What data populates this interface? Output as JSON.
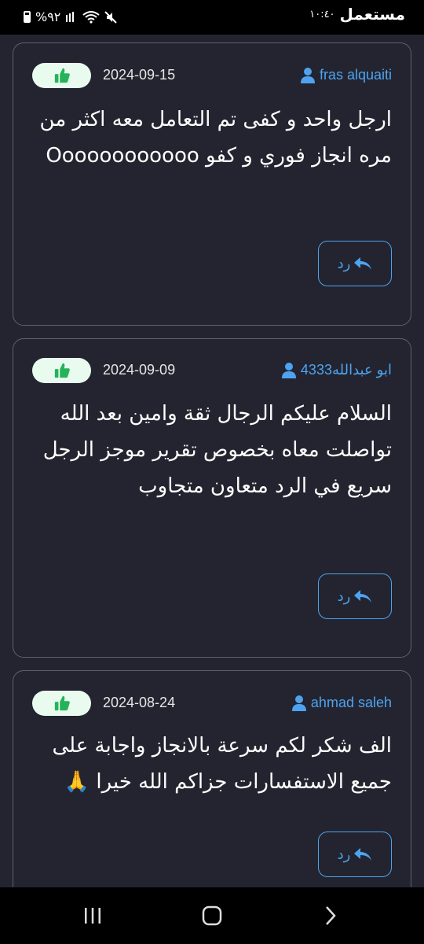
{
  "status_bar": {
    "battery": "%٩٢",
    "time": "١٠:٤٠",
    "app_logo": "مستعمل",
    "icons": [
      "battery-icon",
      "signal-icon",
      "wifi-icon",
      "mute-icon"
    ]
  },
  "colors": {
    "background": "#23242f",
    "card_border": "#5f6070",
    "accent": "#4ea3f1",
    "like_bg": "#e9fbef",
    "like_icon": "#25b35a"
  },
  "reviews": [
    {
      "author": "fras alquaiti",
      "date": "2024-09-15",
      "text": "ارجل واحد و كفى تم التعامل معه اكثر من مره انجاز فوري و كفو Oooooooooooo",
      "reply_label": "رد"
    },
    {
      "author": "ابو عبدالله4333",
      "date": "2024-09-09",
      "text": "السلام عليكم الرجال ثقة وامين بعد الله تواصلت معاه بخصوص تقرير موجز الرجل سريع في الرد متعاون متجاوب",
      "reply_label": "رد"
    },
    {
      "author": "ahmad saleh",
      "date": "2024-08-24",
      "text": "الف شكر لكم سرعة بالانجاز واجابة على جميع الاستفسارات جزاكم الله خيرا 🙏",
      "reply_label": "رد"
    }
  ],
  "nav_bar": {
    "buttons": [
      "recent-apps",
      "home",
      "back"
    ]
  }
}
